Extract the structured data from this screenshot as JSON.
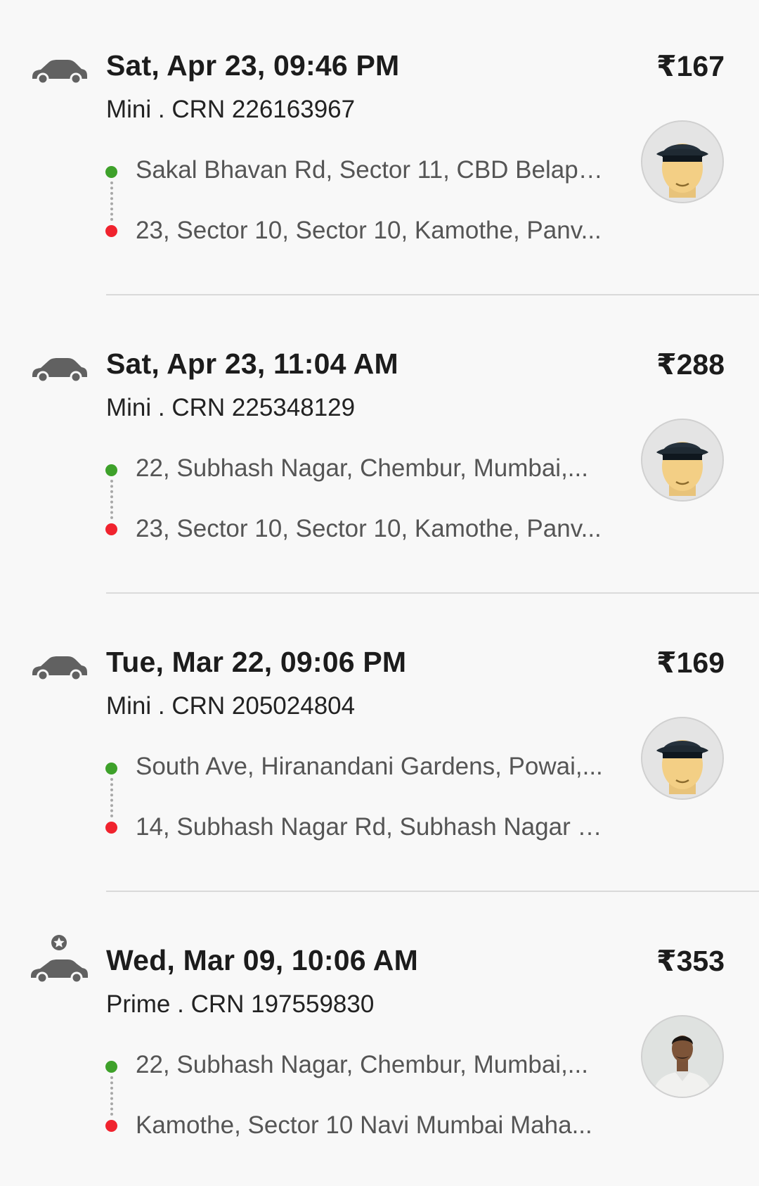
{
  "rides": [
    {
      "car_type": "mini",
      "datetime": "Sat, Apr 23, 09:46 PM",
      "subtitle": "Mini . CRN 226163967",
      "price": "₹167",
      "pickup": "Sakal Bhavan Rd, Sector 11, CBD Belapu...",
      "drop": "23, Sector 10, Sector 10, Kamothe, Panv...",
      "driver_avatar": "driver-cap-icon"
    },
    {
      "car_type": "mini",
      "datetime": "Sat, Apr 23, 11:04 AM",
      "subtitle": "Mini . CRN 225348129",
      "price": "₹288",
      "pickup": "22, Subhash Nagar, Chembur, Mumbai,...",
      "drop": "23, Sector 10, Sector 10, Kamothe, Panv...",
      "driver_avatar": "driver-cap-icon"
    },
    {
      "car_type": "mini",
      "datetime": "Tue, Mar 22, 09:06 PM",
      "subtitle": "Mini . CRN 205024804",
      "price": "₹169",
      "pickup": "South Ave, Hiranandani Gardens, Powai,...",
      "drop": "14, Subhash Nagar Rd, Subhash Nagar R...",
      "driver_avatar": "driver-cap-icon"
    },
    {
      "car_type": "prime",
      "datetime": "Wed, Mar 09, 10:06 AM",
      "subtitle": "Prime . CRN 197559830",
      "price": "₹353",
      "pickup": "22, Subhash Nagar, Chembur, Mumbai,...",
      "drop": "Kamothe, Sector 10 Navi Mumbai Maha...",
      "driver_avatar": "driver-photo"
    }
  ],
  "colors": {
    "pickup_dot": "#3ea12a",
    "drop_dot": "#f0232e",
    "car_icon": "#616161",
    "background": "#f8f8f8"
  }
}
